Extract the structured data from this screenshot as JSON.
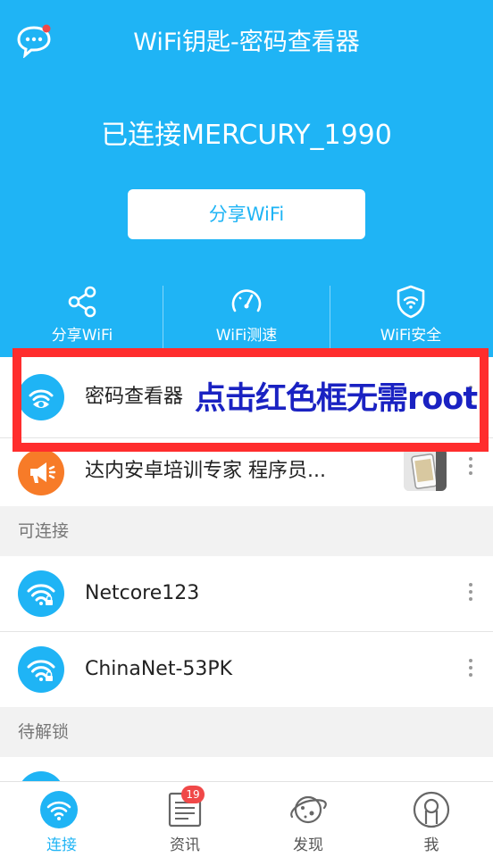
{
  "app": {
    "title": "WiFi钥匙-密码查看器"
  },
  "status": {
    "connected_text": "已连接MERCURY_1990"
  },
  "share_button": {
    "label": "分享WiFi"
  },
  "tools": [
    {
      "label": "分享WiFi",
      "icon": "share-icon"
    },
    {
      "label": "WiFi测速",
      "icon": "speedometer-icon"
    },
    {
      "label": "WiFi安全",
      "icon": "shield-wifi-icon"
    }
  ],
  "featured": [
    {
      "name": "密码查看器",
      "icon": "wifi-eye-icon",
      "icon_color": "#1fb4f5"
    },
    {
      "name": "达内安卓培训专家 程序员...",
      "icon": "megaphone-icon",
      "icon_color": "#f77b28"
    }
  ],
  "annotation": {
    "text": "点击红色框无需root",
    "color": "#1a22c2",
    "frame_color": "#ff2d2d"
  },
  "sections": {
    "connectable": "可连接",
    "locked": "待解锁"
  },
  "networks": [
    {
      "ssid": "Netcore123",
      "icon": "wifi-lock-icon"
    },
    {
      "ssid": "ChinaNet-53PK",
      "icon": "wifi-lock-icon"
    }
  ],
  "tabbar": {
    "tabs": [
      {
        "label": "连接",
        "icon": "wifi-icon",
        "active": true
      },
      {
        "label": "资讯",
        "icon": "news-icon",
        "badge": "19"
      },
      {
        "label": "发现",
        "icon": "planet-icon"
      },
      {
        "label": "我",
        "icon": "user-icon"
      }
    ]
  },
  "colors": {
    "brand": "#1fb4f5",
    "badge": "#f04848",
    "promo": "#f77b28"
  }
}
